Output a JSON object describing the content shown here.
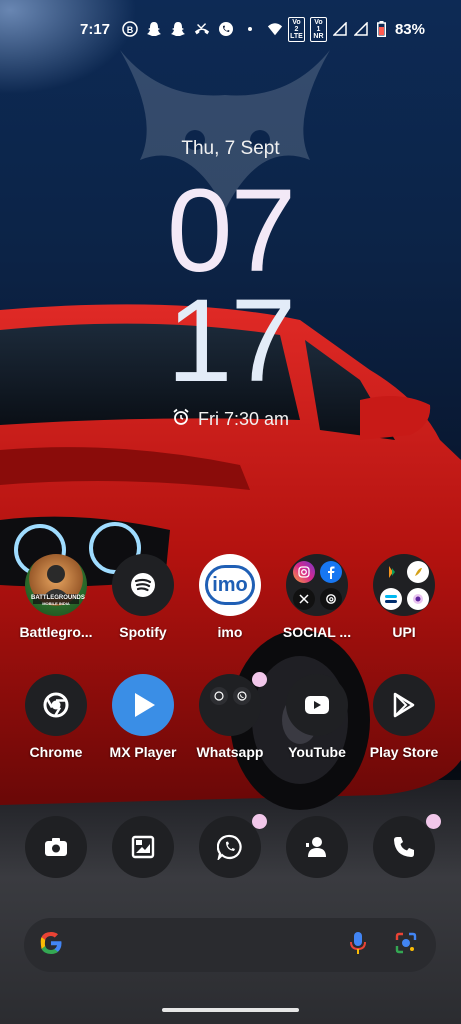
{
  "status_bar": {
    "time": "7:17",
    "battery": "83%",
    "badge_vo_lte_top": "Vo 2",
    "badge_vo_lte_bottom": "LTE",
    "badge_vo_nr_top": "Vo 1",
    "badge_vo_nr_bottom": "NR"
  },
  "clock": {
    "date": "Thu, 7 Sept",
    "hour": "07",
    "minute": "17",
    "alarm": "Fri 7:30 am"
  },
  "apps_row1": [
    {
      "label": "Battlegro...",
      "icon": "battlegrounds-icon"
    },
    {
      "label": "Spotify",
      "icon": "spotify-icon"
    },
    {
      "label": "imo",
      "icon": "imo-icon"
    },
    {
      "label": "SOCIAL ...",
      "icon": "social-folder-icon"
    },
    {
      "label": "UPI",
      "icon": "upi-folder-icon"
    }
  ],
  "apps_row2": [
    {
      "label": "Chrome",
      "icon": "chrome-icon"
    },
    {
      "label": "MX Player",
      "icon": "mx-player-icon"
    },
    {
      "label": "Whatsapp",
      "icon": "whatsapp-folder-icon",
      "notification": true
    },
    {
      "label": "YouTube",
      "icon": "youtube-icon"
    },
    {
      "label": "Play Store",
      "icon": "play-store-icon"
    }
  ],
  "dock": [
    {
      "icon": "camera-icon"
    },
    {
      "icon": "gallery-icon"
    },
    {
      "icon": "whatsapp-icon",
      "notification": true
    },
    {
      "icon": "contacts-icon"
    },
    {
      "icon": "phone-icon",
      "notification": true
    }
  ],
  "imo_text": "imo",
  "battlegrounds_text": "BATTLEGROUNDS",
  "battlegrounds_sub": "MOBILE INDIA",
  "colors": {
    "accent_pink": "#f2c7ea",
    "icon_bg": "#1f2023",
    "search_bg": "#2a2b2f",
    "mx_blue": "#3a8ee6"
  }
}
